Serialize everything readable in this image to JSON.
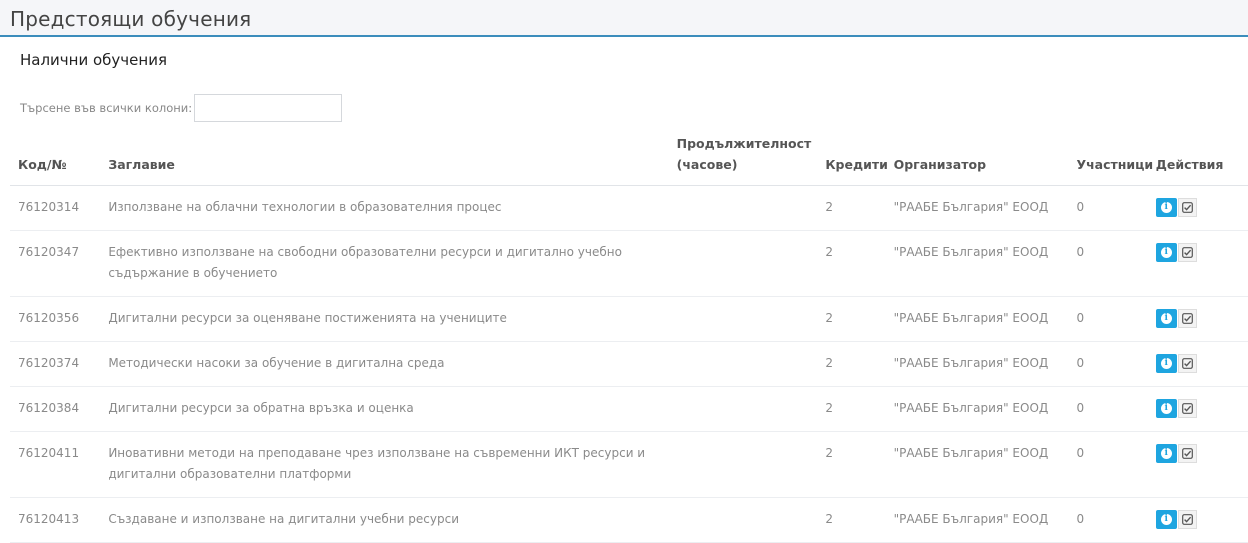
{
  "page": {
    "title": "Предстоящи обучения"
  },
  "card": {
    "title": "Налични обучения"
  },
  "search": {
    "label": "Търсене във всички колони:",
    "value": ""
  },
  "table": {
    "headers": {
      "code": "Код/№",
      "title": "Заглавие",
      "duration": "Продължителност (часове)",
      "credits": "Кредити",
      "organizer": "Организатор",
      "participants": "Участници",
      "actions": "Действия"
    },
    "rows": [
      {
        "code": "76120314",
        "title": "Използване на облачни технологии в образователния процес",
        "credits": "2",
        "organizer": "\"РААБЕ България\" ЕООД",
        "participants": "0"
      },
      {
        "code": "76120347",
        "title": "Ефективно използване на свободни образователни ресурси и дигитално учебно съдържание в обучението",
        "credits": "2",
        "organizer": "\"РААБЕ България\" ЕООД",
        "participants": "0"
      },
      {
        "code": "76120356",
        "title": "Дигитални ресурси за оценяване постиженията на учениците",
        "credits": "2",
        "organizer": "\"РААБЕ България\" ЕООД",
        "participants": "0"
      },
      {
        "code": "76120374",
        "title": "Методически насоки за обучение в дигитална среда",
        "credits": "2",
        "organizer": "\"РААБЕ България\" ЕООД",
        "participants": "0"
      },
      {
        "code": "76120384",
        "title": "Дигитални ресурси за обратна връзка и оценка",
        "credits": "2",
        "organizer": "\"РААБЕ България\" ЕООД",
        "participants": "0"
      },
      {
        "code": "76120411",
        "title": "Иновативни методи на преподаване чрез използване на съвременни ИКТ ресурси и дигитални образователни платформи",
        "credits": "2",
        "organizer": "\"РААБЕ България\" ЕООД",
        "participants": "0"
      },
      {
        "code": "76120413",
        "title": "Създаване и използване на дигитални учебни ресурси",
        "credits": "2",
        "organizer": "\"РААБЕ България\" ЕООД",
        "participants": "0"
      }
    ],
    "row_actions": {
      "info_icon": "info-circle-icon",
      "info_glyph": "i",
      "enroll_icon": "check-square-icon"
    }
  },
  "colors": {
    "accent": "#3c8dbc",
    "info_button": "#1ea5e0",
    "header_bg": "#f5f6f9"
  }
}
